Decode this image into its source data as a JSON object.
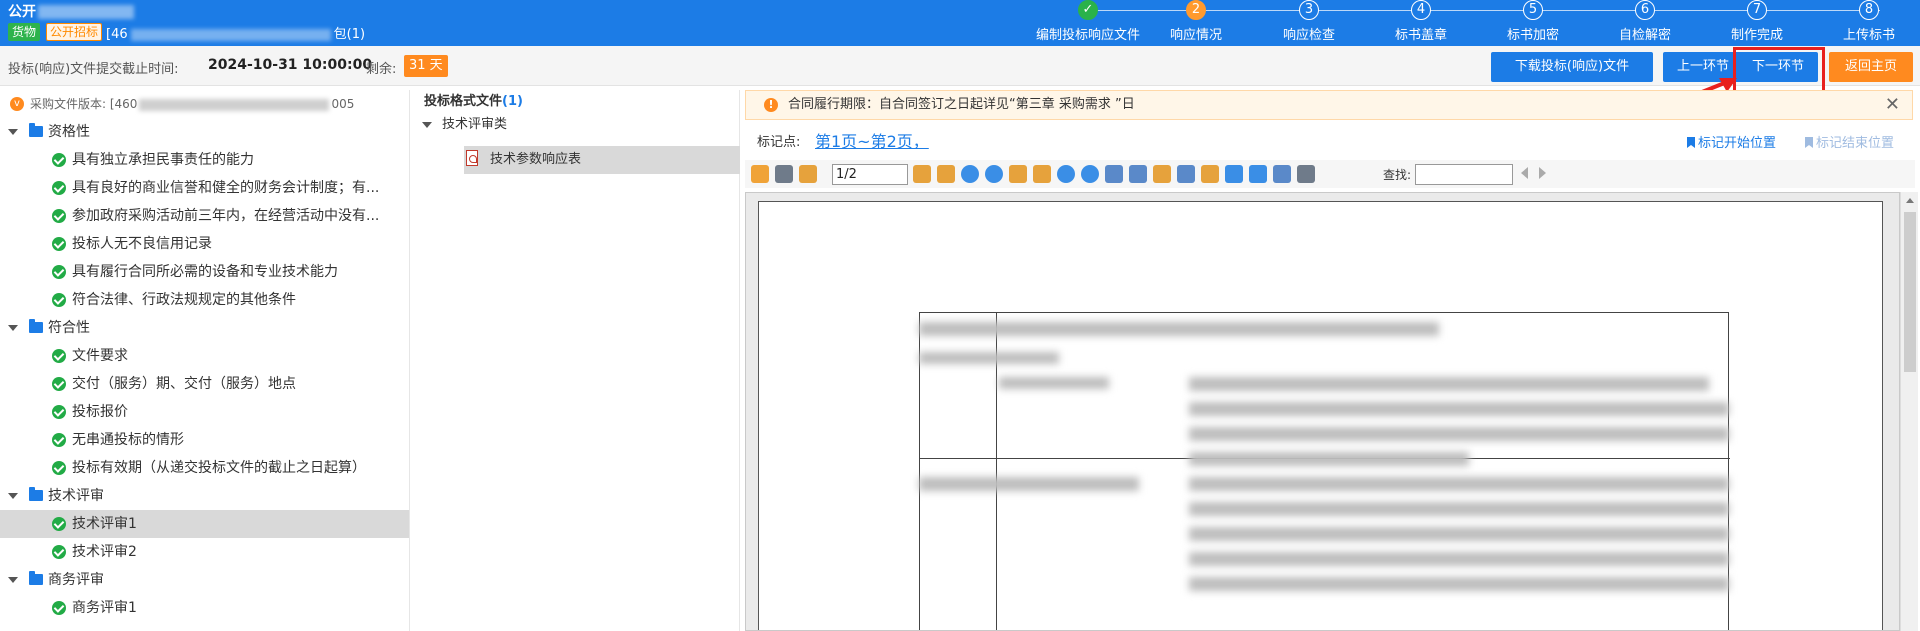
{
  "header": {
    "title": "公开",
    "tag_goods": "货物",
    "tag_method": "公开招标",
    "package_prefix": "[46",
    "package_suffix": "包(1)",
    "steps": [
      {
        "num": "✓",
        "label": "编制投标响应文件",
        "state": "done"
      },
      {
        "num": "2",
        "label": "响应情况",
        "state": "active"
      },
      {
        "num": "3",
        "label": "响应检查",
        "state": "todo"
      },
      {
        "num": "4",
        "label": "标书盖章",
        "state": "todo"
      },
      {
        "num": "5",
        "label": "标书加密",
        "state": "todo"
      },
      {
        "num": "6",
        "label": "自检解密",
        "state": "todo"
      },
      {
        "num": "7",
        "label": "制作完成",
        "state": "todo"
      },
      {
        "num": "8",
        "label": "上传标书",
        "state": "todo"
      }
    ]
  },
  "subbar": {
    "deadline_label": "投标(响应)文件提交截止时间:",
    "deadline_value": "2024-10-31 10:00:00",
    "remain_label": "剩余:",
    "remain_value": "31 天",
    "download_label": "下载投标(响应)文件",
    "prev_label": "上一环节",
    "next_label": "下一环节",
    "home_label": "返回主页"
  },
  "left": {
    "version_prefix": "采购文件版本: [460",
    "version_suffix": "005",
    "groups": [
      {
        "label": "资格性",
        "items": [
          "具有独立承担民事责任的能力",
          "具有良好的商业信誉和健全的财务会计制度；有...",
          "参加政府采购活动前三年内，在经营活动中没有...",
          "投标人无不良信用记录",
          "具有履行合同所必需的设备和专业技术能力",
          "符合法律、行政法规规定的其他条件"
        ]
      },
      {
        "label": "符合性",
        "items": [
          "文件要求",
          "交付（服务）期、交付（服务）地点",
          "投标报价",
          "无串通投标的情形",
          "投标有效期（从递交投标文件的截止之日起算）"
        ]
      },
      {
        "label": "技术评审",
        "items": [
          "技术评审1",
          "技术评审2"
        ]
      },
      {
        "label": "商务评审",
        "items": [
          "商务评审1"
        ]
      }
    ]
  },
  "middle": {
    "title": "投标格式文件",
    "count": "(1)",
    "category": "技术评审类",
    "file": "技术参数响应表"
  },
  "right": {
    "notice": "合同履行期限：自合同签订之日起详见“第三章 采购需求 ”日",
    "notice_icon": "!",
    "close_icon": "✕",
    "bookmark_label": "标记点:",
    "bookmark_pages": "第1页~第2页，",
    "mark_start": "标记开始位置",
    "mark_end": "标记结束位置",
    "page_value": "1/2",
    "find_label": "查找:"
  }
}
